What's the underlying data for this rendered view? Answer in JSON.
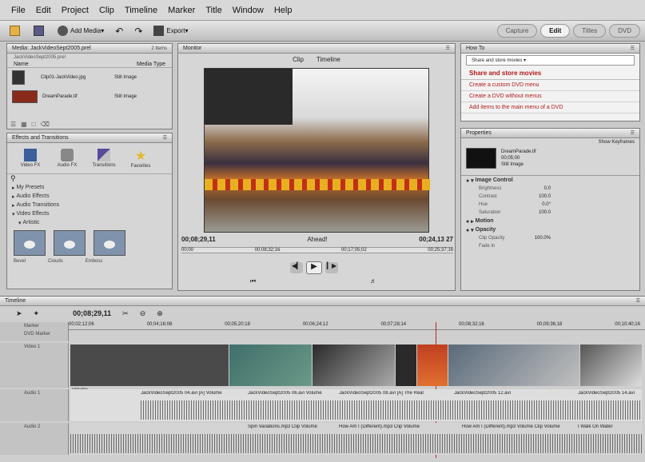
{
  "menu": [
    "File",
    "Edit",
    "Project",
    "Clip",
    "Timeline",
    "Marker",
    "Title",
    "Window",
    "Help"
  ],
  "toolbar": {
    "add_media": "Add Media",
    "export": "Export"
  },
  "modes": {
    "capture": "Capture",
    "edit": "Edit",
    "titles": "Titles",
    "dvd": "DVD"
  },
  "media_panel": {
    "title": "Media: JackVideoSept2005.prel",
    "count": "2 Items",
    "path": "JackVideoSept2005.prel",
    "col_name": "Name",
    "col_type": "Media Type",
    "items": [
      {
        "name": "Clip01-JackVideo.jpg",
        "type": "Still Image"
      },
      {
        "name": "DreamParade.tif",
        "type": "Still Image"
      }
    ]
  },
  "effects_panel": {
    "title": "Effects and Transitions",
    "buttons": [
      "Video FX",
      "Audio FX",
      "Transitions",
      "Favorites"
    ],
    "tree": [
      "My Presets",
      "Audio Effects",
      "Audio Transitions",
      "Video Effects",
      "Artistic"
    ],
    "thumb_labels": [
      "Bevel",
      "Clouds",
      "Emboss"
    ]
  },
  "monitor": {
    "title": "Monitor",
    "clip_tab": "Clip",
    "timeline_tab": "Timeline",
    "current_time": "00;08;29,11",
    "clip_label": "Ahead!",
    "duration": "00;24,13 27",
    "ruler": [
      "00;00",
      "00;08;32;16",
      "00;17;05;02",
      "00;25;37;16"
    ]
  },
  "how_to": {
    "title": "How To",
    "subtitle": "Share and store movies",
    "dropdown": "Share and store movies",
    "heading": "Share and store movies",
    "links": [
      "Create a custom DVD menu",
      "Create a DVD without menus",
      "Add items to the main menu of a DVD"
    ]
  },
  "properties": {
    "title": "Properties",
    "show": "Show Keyframes",
    "clip_name": "DreamParade.tif",
    "clip_dims": "00;05;00",
    "clip_type": "Still Image",
    "sections": [
      {
        "name": "Image Control",
        "rows": [
          {
            "k": "Brightness",
            "v": "0.0"
          },
          {
            "k": "Contrast",
            "v": "100.0"
          },
          {
            "k": "Hue",
            "v": "0.0°"
          },
          {
            "k": "Saturation",
            "v": "100.0"
          }
        ]
      },
      {
        "name": "Motion",
        "rows": []
      },
      {
        "name": "Opacity",
        "rows": [
          {
            "k": "Clip Opacity",
            "v": "100.0%"
          },
          {
            "k": "Fade In",
            "v": ""
          }
        ]
      }
    ]
  },
  "timeline": {
    "title": "Timeline",
    "time": "00;08;29,11",
    "markers": [
      "00;02;12;06",
      "00;04;16;08",
      "00;05;20;18",
      "00;06;24;12",
      "00;07;28;14",
      "00;08;32;16",
      "00;09;36;18",
      "00;10;40;16"
    ],
    "tracks": {
      "menu_marker": "Marker",
      "dvd_marker": "DVD Marker",
      "video": "Video 1",
      "audio1": "Audio 1",
      "audio2": "Audio 2"
    },
    "video_clip_label": "Volume",
    "audio_clips": [
      "JackVideoSept2005 04.avi [A] Volume",
      "JackVideoSept2005 06.avi Volume",
      "JackVideoSept2005 08.avi [A] The Real",
      "JackVideoSept2005 12.avi",
      "JackVideoSept2005 14.avi"
    ],
    "audio2_clips": [
      "Spin Variations.mp3 Clip Volume",
      "How Am I (Different).mp3 Clip Volume",
      "How Am I (Different).mp3 Volume Clip Volume",
      "I Walk On Water"
    ]
  },
  "colors": {
    "accent": "#b21a1a",
    "panel": "#d6d6d6"
  }
}
